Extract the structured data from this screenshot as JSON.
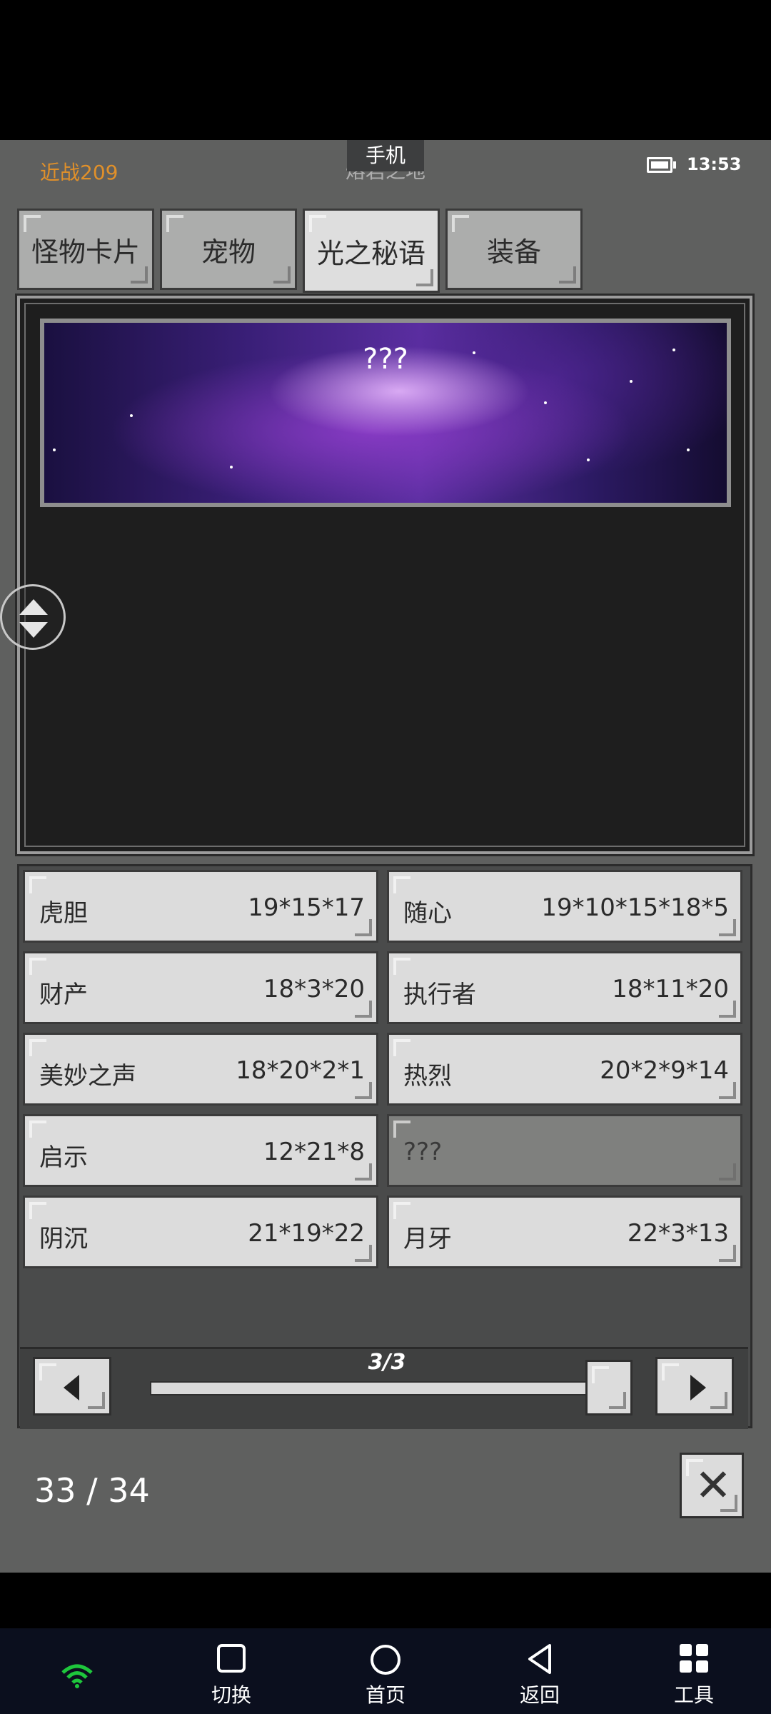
{
  "status": {
    "left_text": "近战209",
    "title_tag": "手机",
    "title": "熔岩之地",
    "time": "13:53"
  },
  "tabs": [
    {
      "label": "怪物卡片",
      "active": false
    },
    {
      "label": "宠物",
      "active": false
    },
    {
      "label": "光之秘语",
      "active": true
    },
    {
      "label": "装备",
      "active": false
    }
  ],
  "banner": {
    "title": "???"
  },
  "items": [
    {
      "name": "虎胆",
      "value": "19*15*17"
    },
    {
      "name": "随心",
      "value": "19*10*15*18*5"
    },
    {
      "name": "财产",
      "value": "18*3*20"
    },
    {
      "name": "执行者",
      "value": "18*11*20"
    },
    {
      "name": "美妙之声",
      "value": "18*20*2*1"
    },
    {
      "name": "热烈",
      "value": "20*2*9*14"
    },
    {
      "name": "启示",
      "value": "12*21*8"
    },
    {
      "name": "???",
      "value": "",
      "locked": true
    },
    {
      "name": "阴沉",
      "value": "21*19*22"
    },
    {
      "name": "月牙",
      "value": "22*3*13"
    }
  ],
  "pager": {
    "label": "3/3",
    "progress": 1.0
  },
  "count": "33 / 34",
  "navbar": {
    "switch": "切换",
    "home": "首页",
    "back": "返回",
    "tools": "工具"
  }
}
